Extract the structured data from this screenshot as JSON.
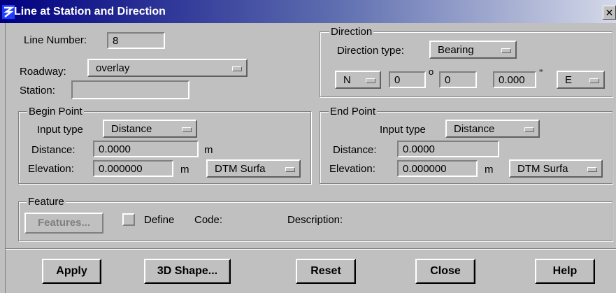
{
  "window": {
    "title": "Line at Station and Direction",
    "close_glyph": "✕"
  },
  "line_number": {
    "label": "Line Number:",
    "value": "8"
  },
  "roadway": {
    "label": "Roadway:",
    "value": "overlay"
  },
  "station": {
    "label": "Station:",
    "value": ""
  },
  "direction": {
    "legend": "Direction",
    "type_label": "Direction type:",
    "type_value": "Bearing",
    "ns": "N",
    "degrees": "0",
    "degree_symbol": "o",
    "minutes": "0",
    "seconds": "0.000",
    "seconds_symbol": "''",
    "ew": "E"
  },
  "begin_point": {
    "legend": "Begin Point",
    "input_type_label": "Input type",
    "input_type_value": "Distance",
    "distance_label": "Distance:",
    "distance_value": "0.0000",
    "distance_unit": "m",
    "elevation_label": "Elevation:",
    "elevation_value": "0.000000",
    "elevation_unit": "m",
    "elevation_source": "DTM Surfa"
  },
  "end_point": {
    "legend": "End Point",
    "input_type_label": "Input type",
    "input_type_value": "Distance",
    "distance_label": "Distance:",
    "distance_value": "0.0000",
    "elevation_label": "Elevation:",
    "elevation_value": "0.000000",
    "elevation_unit": "m",
    "elevation_source": "DTM Surfa"
  },
  "feature": {
    "legend": "Feature",
    "features_button": "Features...",
    "define_label": "Define",
    "define_checked": false,
    "code_label": "Code:",
    "description_label": "Description:"
  },
  "buttons": {
    "apply": "Apply",
    "shape3d": "3D Shape...",
    "reset": "Reset",
    "close": "Close",
    "help": "Help"
  },
  "colors": {
    "title_bar": "#000080",
    "face": "#c0c0c0"
  }
}
